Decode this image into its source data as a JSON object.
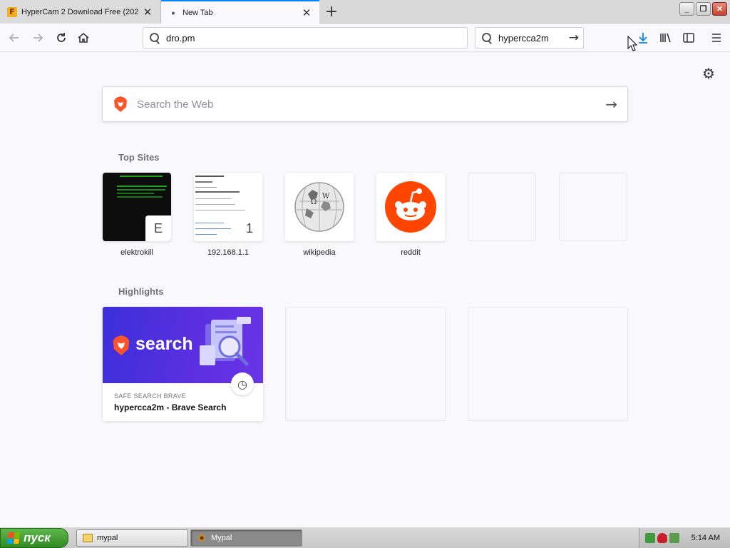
{
  "tabs": [
    {
      "title": "HyperCam 2 Download Free (202",
      "favicon": "hypercam-favicon"
    },
    {
      "title": "New Tab",
      "favicon": "dot"
    }
  ],
  "window_controls": {
    "minimize": "_",
    "restore": "❐",
    "close": "✕"
  },
  "nav": {
    "url": "dro.pm",
    "search_value": "hypercca2m"
  },
  "content": {
    "websearch_placeholder": "Search the Web",
    "top_sites_title": "Top Sites",
    "top_sites": [
      {
        "label": "elektrokill",
        "letter": "E"
      },
      {
        "label": "192.168.1.1",
        "letter": "1"
      },
      {
        "label": "wikipedia"
      },
      {
        "label": "reddit"
      }
    ],
    "highlights_title": "Highlights",
    "highlight": {
      "image_text": "search",
      "source": "SAFE SEARCH BRAVE",
      "title": "hypercca2m - Brave Search"
    }
  },
  "taskbar": {
    "start_label": "пуск",
    "items": [
      {
        "label": "mypal",
        "icon": "folder-icon",
        "state": "idle"
      },
      {
        "label": "Mypal",
        "icon": "mypal-icon",
        "state": "pressed"
      }
    ],
    "clock": "5:14 AM"
  },
  "colors": {
    "accent": "#0a84ff",
    "brave_orange": "#fb542b",
    "reddit_orange": "#ff4500",
    "highlight_purple": "#4b2fdc",
    "start_green": "#3c9a2c"
  }
}
